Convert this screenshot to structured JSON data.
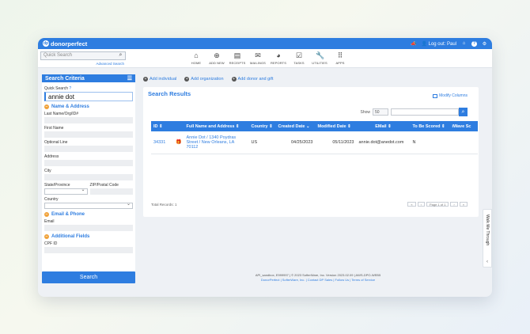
{
  "app": {
    "logo_text": "donorperfect",
    "logout_label": "Log out: Paul"
  },
  "topsearch": {
    "placeholder": "Quick Search",
    "advanced_label": "Advanced Search"
  },
  "menu": [
    {
      "label": "HOME",
      "icon": "home-icon"
    },
    {
      "label": "ADD NEW",
      "icon": "add-new-icon"
    },
    {
      "label": "RECEIPTS",
      "icon": "receipts-icon"
    },
    {
      "label": "MAILINGS",
      "icon": "mailings-icon"
    },
    {
      "label": "REPORTS",
      "icon": "reports-icon"
    },
    {
      "label": "TASKS",
      "icon": "tasks-icon"
    },
    {
      "label": "UTILITIES",
      "icon": "utilities-icon"
    },
    {
      "label": "APPS",
      "icon": "apps-icon"
    }
  ],
  "criteria": {
    "title": "Search Criteria",
    "quick_search_label": "Quick Search",
    "quick_search_value": "annie dot",
    "name_section": "Name & Address",
    "lastname_label": "Last Name/Org/ID#",
    "firstname_label": "First Name",
    "optline_label": "Optional Line",
    "address_label": "Address",
    "city_label": "City",
    "state_label": "State/Province",
    "zip_label": "ZIP/Postal Code",
    "country_label": "Country",
    "email_section": "Email & Phone",
    "email_label": "Email",
    "additional_section": "Additional Fields",
    "cpf_label": "CPF ID",
    "search_button": "Search"
  },
  "actions": {
    "add_individual": "Add individual",
    "add_organization": "Add organization",
    "add_donor_gift": "Add donor and gift"
  },
  "results": {
    "title": "Search Results",
    "modify_columns": "Modify Columns",
    "show_label": "Show",
    "show_value": "50",
    "columns": [
      "ID",
      "Full Name and Address",
      "Country",
      "Created Date",
      "Modified Date",
      "EMail",
      "To Be Scored",
      "iWave Sc"
    ],
    "rows": [
      {
        "id": "34331",
        "name_address": "Annie Dot / 1340 Poydras Street / New Orleans, LA 70112",
        "country": "US",
        "created": "04/25/2023",
        "modified": "05/11/2023",
        "email": "annie.dot@anedot.com",
        "to_be_scored": "N",
        "iwave": ""
      }
    ],
    "total_records": "Total Records: 1",
    "page_info": "Page 1 of 1"
  },
  "footer": {
    "line1": "API_sandbox, E999997 | © 2023 SofterWare, Inc. Version 2023.02.09 | AWS-DPO-WEB5",
    "line2": "DonorPerfect | SofterWare, Inc. | Contact DP Sales | Follow Us | Terms of Service"
  },
  "walkme": {
    "label": "Walk Me Through"
  }
}
